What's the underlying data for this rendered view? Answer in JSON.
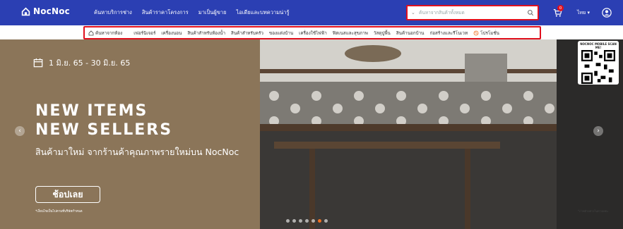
{
  "header": {
    "logo_text": "NocNoc",
    "nav": [
      "ค้นหาบริการช่าง",
      "สินค้าราคาโครงการ",
      "มาเป็นผู้ขาย",
      "ไอเดียและบทความน่ารู้"
    ],
    "search_placeholder": "ค้นหาจากสินค้าทั้งหมด",
    "cart_count": "0",
    "language": "ไทย ▾",
    "colors": {
      "bar": "#2b3fb3",
      "highlight": "#e0101e"
    }
  },
  "categories": {
    "home_label": "ค้นหาจากห้อง",
    "items": [
      "เฟอร์นิเจอร์",
      "เครื่องนอน",
      "สินค้าสำหรับห้องน้ำ",
      "สินค้าสำหรับครัว",
      "ของแต่งบ้าน",
      "เครื่องใช้ไฟฟ้า",
      "ฟิตเนสและสุขภาพ",
      "วัสดุปูพื้น",
      "สินค้านอกบ้าน",
      "ก่อสร้างและรีโนเวท"
    ],
    "promo_label": "โปรโมชั่น"
  },
  "hero": {
    "date": "1 มิ.ย. 65 - 30 มิ.ย. 65",
    "headline_1": "NEW ITEMS",
    "headline_2": "NEW SELLERS",
    "subheadline": "สินค้ามาใหม่ จากร้านค้าคุณภาพรายใหม่บน NocNoc",
    "cta": "ช้อปเลย",
    "disclaimer": "*เงื่อนไขเป็นไปตามที่บริษัทกำหนด",
    "qr_label": "NOCNOC MOBILE SCAN ME!",
    "right_note": "*ภาพตัวอย่างในทางแทน"
  }
}
